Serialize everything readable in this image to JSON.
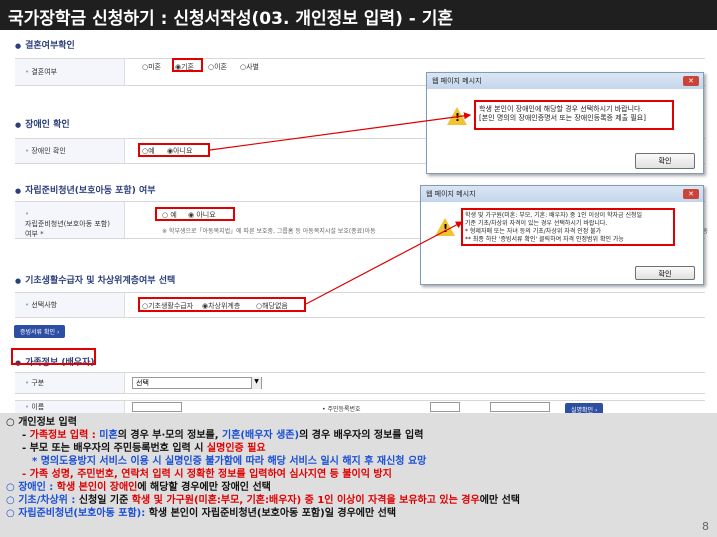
{
  "title": "국가장학금 신청하기 : 신청서작성(03. 개인정보 입력) - 기혼",
  "sections": {
    "marriage": {
      "heading": "결혼여부확인",
      "label": "결혼여부",
      "options": [
        "미혼",
        "기혼",
        "이혼",
        "사별"
      ],
      "selected": "기혼"
    },
    "disability": {
      "heading": "장애인 확인",
      "label": "장애인 확인",
      "options": [
        "예",
        "아니요"
      ],
      "selected": "아니요"
    },
    "selfreliance": {
      "heading": "자립준비청년(보호아동 포함) 여부",
      "label1": "자립준비청년(보호아동 포함)",
      "label2": "여부 *",
      "options": [
        "예",
        "아니요"
      ],
      "selected": "아니요",
      "note": "※ 학부생으로「아동복지법」에 따른 보호중, 그룹홈 등 아동복지시설 보호(종료)아동",
      "note_tail": "아동"
    },
    "basic": {
      "heading": "기초생활수급자 및 차상위계층여부 선택",
      "label": "선택사항",
      "options": [
        "기초생활수급자",
        "차상위계층",
        "해당없음"
      ],
      "selected": "차상위계층",
      "proof_button": "증빙서류 확인"
    },
    "family": {
      "heading": "가족정보 (배우자)",
      "label_type": "구분",
      "select_value": "선택",
      "label_name": "이름",
      "label_rrn": "주민등록번호",
      "verify_button": "실명확인"
    }
  },
  "dialog1": {
    "title": "웹 페이지 메시지",
    "line1": "학생 본인이 장애인에 해당할 경우 선택하시기 바랍니다.",
    "line2": "[본인 명의의 장애인증명서 또는 장애인등록증 제출 필요]",
    "ok": "확인"
  },
  "dialog2": {
    "title": "웹 페이지 메시지",
    "line1": "학생 및 가구원(미혼: 부모, 기혼: 배우자) 중 1인 이상이 학자금 신청일",
    "line2": "기준 기초/차상위 자격이 있는 경우 선택하시기 바랍니다.",
    "line3": "* 형제자매 또는 자녀 등의 기초/차상위 자격 인정 불가",
    "line4": "** 최종 하단 '증빙서류 확인' 클릭하여 자격 인정범위 확인 가능",
    "ok": "확인"
  },
  "notes": {
    "n1": "○ 개인정보 입력",
    "n2_pre": "- ",
    "n2_a": "가족정보 입력 : ",
    "n2_b": "미혼",
    "n2_c": "의 경우 부·모의 정보를, ",
    "n2_d": "기혼(배우자 생존)",
    "n2_e": "의 경우 배우자의 정보를 입력",
    "n3_a": "- 부모 또는 배우자의 주민등록번호 입력 시 ",
    "n3_b": "실명인증 필요",
    "n4": "* 명의도용방지 서비스 이용 시 실명인증 불가함에 따라 해당 서비스 일시 해지 후 재신청 요망",
    "n5": "- 가족 성명, 주민번호, 연락처 입력 시 정확한 정보를 입력하여 심사지연 등 불이익 방지",
    "n6_a": "○ 장애인 : ",
    "n6_b": "학생 본인이 장애인",
    "n6_c": "에 해당할 경우에만 장애인 선택",
    "n7_a": "○ 기초/차상위 : ",
    "n7_b": "신청일 기준 ",
    "n7_c": "학생 및 가구원(미혼:부모, 기혼:배우자) 중 1인 이상이 자격을 보유하고 있는 경우",
    "n7_d": "에만 선택",
    "n8_a": "○ 자립준비청년(보호아동 포함): ",
    "n8_b": "학생 본인이 자립준비청년(보호아동 포함)일 경우에만 선택",
    "page": "8"
  }
}
